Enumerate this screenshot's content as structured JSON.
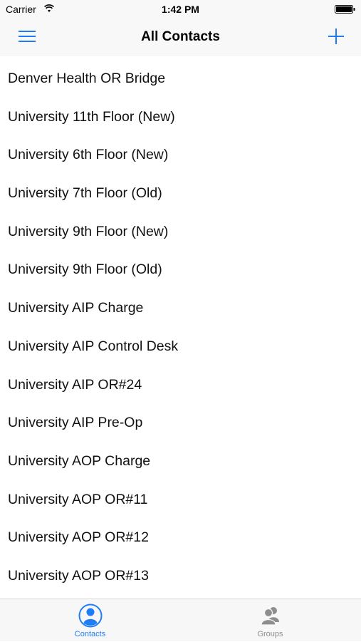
{
  "status_bar": {
    "carrier": "Carrier",
    "time": "1:42 PM",
    "wifi_icon": "wifi-icon",
    "battery_icon": "battery-icon"
  },
  "nav_bar": {
    "title": "All Contacts",
    "menu_icon": "hamburger-menu-icon",
    "add_icon": "plus-icon"
  },
  "contacts": [
    "Denver Health OR Bridge",
    "University 11th Floor (New)",
    "University 6th Floor (New)",
    "University 7th Floor (Old)",
    "University 9th Floor (New)",
    "University 9th Floor (Old)",
    "University AIP Charge",
    "University AIP Control Desk",
    "University AIP OR#24",
    "University AIP Pre-Op",
    "University AOP Charge",
    "University AOP OR#11",
    "University AOP OR#12",
    "University AOP OR#13"
  ],
  "tab_bar": {
    "tabs": [
      {
        "label": "Contacts",
        "icon": "person-icon",
        "selected": true
      },
      {
        "label": "Groups",
        "icon": "group-icon",
        "selected": false
      }
    ]
  },
  "colors": {
    "accent": "#1e7cf7",
    "inactive": "#8e8e8e",
    "bar_background": "#f8f8f8"
  }
}
